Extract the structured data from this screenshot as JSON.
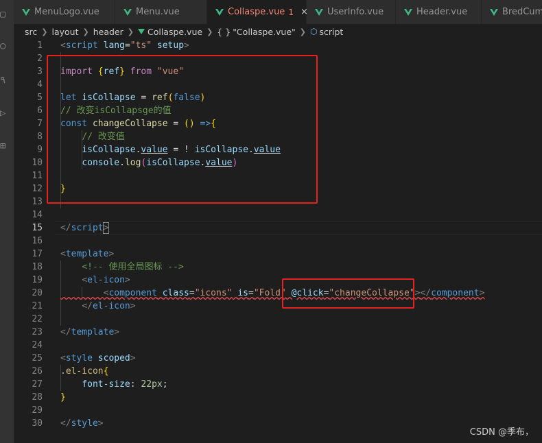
{
  "tabs": [
    {
      "label": "MenuLogo.vue",
      "active": false
    },
    {
      "label": "Menu.vue",
      "active": false
    },
    {
      "label": "Collaspe.vue",
      "active": true,
      "modified": "1",
      "close": "×"
    },
    {
      "label": "UserInfo.vue",
      "active": false
    },
    {
      "label": "Header.vue",
      "active": false
    },
    {
      "label": "BredCum.vue",
      "active": false
    }
  ],
  "breadcrumb": {
    "parts": [
      "src",
      "layout",
      "header",
      "Collaspe.vue",
      "\"Collaspe.vue\"",
      "script"
    ],
    "braces": "{ }"
  },
  "line_numbers": [
    "1",
    "2",
    "3",
    "4",
    "5",
    "6",
    "7",
    "8",
    "9",
    "10",
    "11",
    "12",
    "13",
    "14",
    "15",
    "16",
    "17",
    "18",
    "19",
    "20",
    "21",
    "22",
    "23",
    "24",
    "25",
    "26",
    "27",
    "28",
    "29",
    "30"
  ],
  "code": {
    "l1": {
      "open": "<",
      "tag": "script",
      "attr1": "lang",
      "eq": "=",
      "val1": "\"ts\"",
      "attr2": "setup",
      "close": ">"
    },
    "l3": {
      "kw": "import",
      "b1": "{",
      "name": "ref",
      "b2": "}",
      "from": "from",
      "src": "\"vue\""
    },
    "l5": {
      "kw": "let",
      "name": "isCollapse",
      "eq": " = ",
      "fn": "ref",
      "b1": "(",
      "arg": "false",
      "b2": ")"
    },
    "l6": {
      "comment": "// 改变isCollapsge的值"
    },
    "l7": {
      "kw": "const",
      "name": "changeCollapse",
      "eq": " = ",
      "p": "()",
      "arrow": " =>",
      "b": "{"
    },
    "l8": {
      "comment": "// 改变值"
    },
    "l9": {
      "a": "isCollapse",
      "dot": ".",
      "b": "value",
      "mid": " = ! ",
      "c": "isCollapse",
      "dot2": ".",
      "d": "value"
    },
    "l10": {
      "a": "console",
      "dot": ".",
      "fn": "log",
      "b1": "(",
      "c": "isCollapse",
      "dot2": ".",
      "d": "value",
      "b2": ")"
    },
    "l12": {
      "b": "}"
    },
    "l15": {
      "open": "</",
      "tag": "script",
      "close": ">"
    },
    "l17": {
      "open": "<",
      "tag": "template",
      "close": ">"
    },
    "l18": {
      "comment": "<!-- 使用全局图标 -->"
    },
    "l19": {
      "open": "<",
      "tag": "el-icon",
      "close": ">"
    },
    "l20": {
      "open": "<",
      "tag": "component",
      "a1": "class",
      "v1": "\"icons\"",
      "a2": "is",
      "v2": "\"Fold\"",
      "a3": "@click",
      "eq": "=",
      "v3": "\"changeCollapse\"",
      "close": ">",
      "end_open": "</",
      "end_tag": "component",
      "end_close": ">"
    },
    "l21": {
      "open": "</",
      "tag": "el-icon",
      "close": ">"
    },
    "l23": {
      "open": "</",
      "tag": "template",
      "close": ">"
    },
    "l25": {
      "open": "<",
      "tag": "style",
      "attr": "scoped",
      "close": ">"
    },
    "l26": {
      "sel": ".el-icon",
      "b": "{"
    },
    "l27": {
      "prop": "font-size",
      "colon": ": ",
      "num": "22px",
      "semi": ";"
    },
    "l28": {
      "b": "}"
    },
    "l30": {
      "open": "</",
      "tag": "style",
      "close": ">"
    }
  },
  "watermark": "CSDN @季布，",
  "colors": {
    "annotation": "#e8231f",
    "vue_icon": "#41b883",
    "active_tab_text": "#f48771"
  }
}
